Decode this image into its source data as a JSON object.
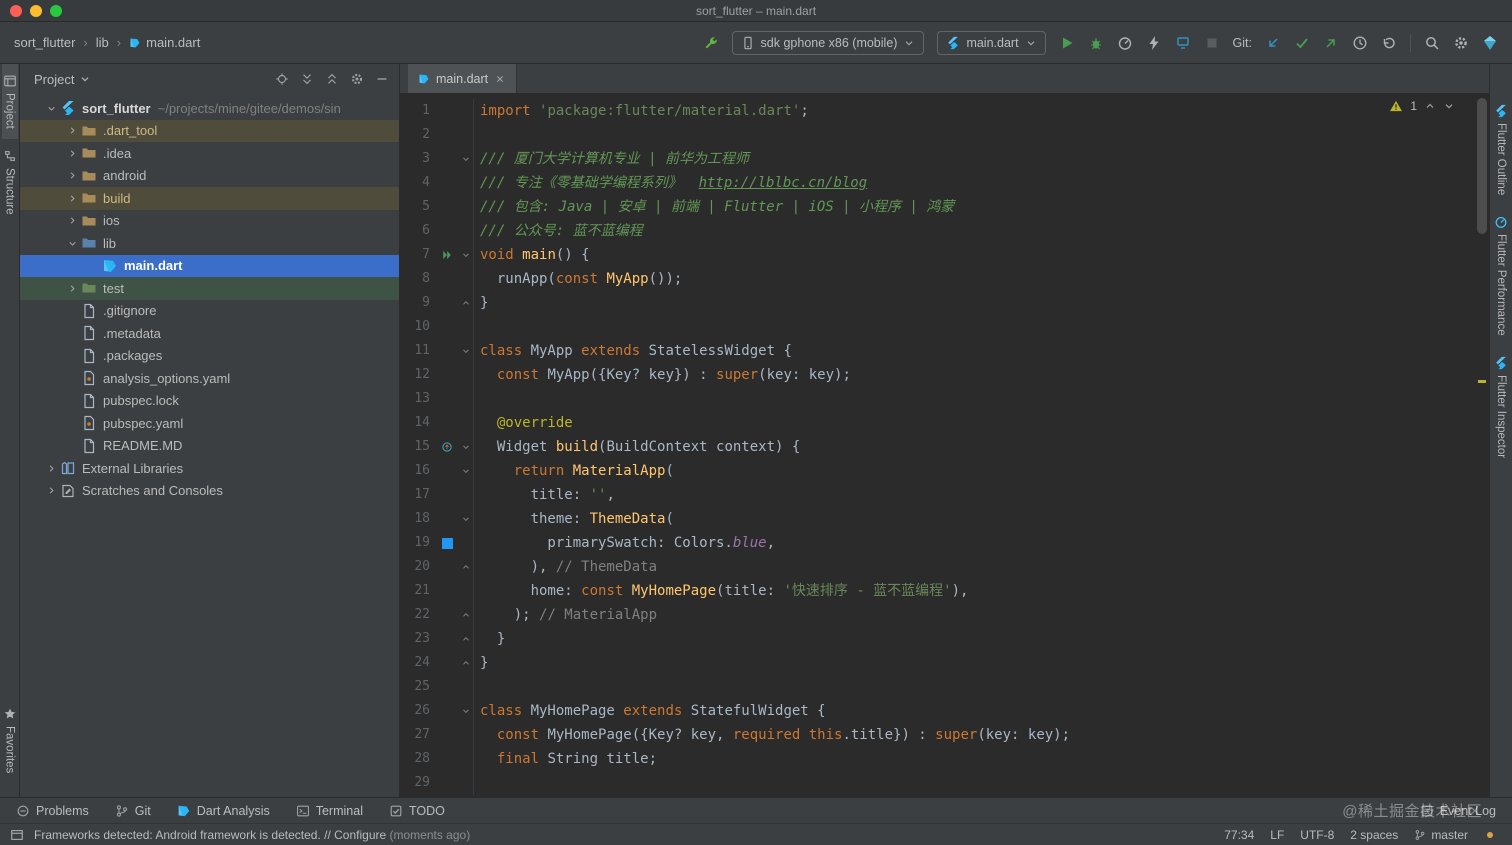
{
  "window": {
    "title": "sort_flutter – main.dart"
  },
  "breadcrumb": {
    "separator": "›",
    "items": [
      {
        "label": "sort_flutter"
      },
      {
        "label": "lib"
      },
      {
        "label": "main.dart",
        "icon": "dart"
      }
    ]
  },
  "toolbar": {
    "actions": [
      {
        "kind": "icon",
        "name": "flutter-attach-button",
        "icon": "wrench",
        "color": "#62B543"
      },
      {
        "kind": "select",
        "name": "device-selector",
        "icon": "phone",
        "icon_color": "#AFB1B3",
        "label": "sdk gphone x86 (mobile)"
      },
      {
        "kind": "select",
        "name": "run-config-selector",
        "icon": "flutter",
        "label": "main.dart"
      },
      {
        "kind": "icon",
        "name": "run-button",
        "icon": "play",
        "color": "#499C54"
      },
      {
        "kind": "icon",
        "name": "debug-button",
        "icon": "bug",
        "color": "#499C54"
      },
      {
        "kind": "icon",
        "name": "profile-button",
        "icon": "gauge",
        "color": "#AFB1B3"
      },
      {
        "kind": "icon",
        "name": "attach-debugger-button",
        "icon": "bolt",
        "color": "#AFB1B3"
      },
      {
        "kind": "icon",
        "name": "devtools-button",
        "icon": "devices",
        "color": "#3592C4"
      },
      {
        "kind": "icon",
        "name": "stop-button",
        "icon": "stop",
        "color": "#5A5D5E"
      },
      {
        "kind": "label",
        "name": "git-label",
        "text": "Git:"
      },
      {
        "kind": "icon",
        "name": "git-update-button",
        "icon": "arrowDL",
        "color": "#3592C4"
      },
      {
        "kind": "icon",
        "name": "git-commit-button",
        "icon": "check",
        "color": "#499C54"
      },
      {
        "kind": "icon",
        "name": "git-push-button",
        "icon": "arrowUR",
        "color": "#499C54"
      },
      {
        "kind": "icon",
        "name": "git-history-button",
        "icon": "clock",
        "color": "#AFB1B3"
      },
      {
        "kind": "icon",
        "name": "git-rollback-button",
        "icon": "undo",
        "color": "#AFB1B3"
      },
      {
        "kind": "sep"
      },
      {
        "kind": "icon",
        "name": "search-everywhere-button",
        "icon": "search",
        "color": "#AFB1B3"
      },
      {
        "kind": "icon",
        "name": "settings-button",
        "icon": "gear",
        "color": "#AFB1B3"
      },
      {
        "kind": "icon",
        "name": "plugin-profile-button",
        "icon": "gem",
        "color": "#54C5F8"
      }
    ]
  },
  "left_strip": {
    "top": [
      {
        "name": "tool-tab-project",
        "label": "Project",
        "icon": "projecttab",
        "active": true
      },
      {
        "name": "tool-tab-structure",
        "label": "Structure",
        "icon": "structure"
      }
    ],
    "bottom": [
      {
        "name": "tool-tab-favorites",
        "label": "Favorites",
        "icon": "star"
      }
    ]
  },
  "right_strip": {
    "tabs": [
      {
        "name": "tool-tab-flutter-outline",
        "label": "Flutter Outline",
        "icon": "flutter"
      },
      {
        "name": "tool-tab-flutter-performance",
        "label": "Flutter Performance",
        "icon": "gauge",
        "icon_color": "#40C4FF"
      },
      {
        "name": "tool-tab-flutter-inspector",
        "label": "Flutter Inspector",
        "icon": "flutter"
      }
    ]
  },
  "project_panel": {
    "title": "Project",
    "header_actions": [
      {
        "name": "locate-file-button",
        "icon": "crosshair"
      },
      {
        "name": "expand-all-button",
        "icon": "expandAll"
      },
      {
        "name": "collapse-all-button",
        "icon": "collapseAll"
      },
      {
        "name": "panel-settings-button",
        "icon": "gear"
      },
      {
        "name": "hide-panel-button",
        "icon": "minus"
      }
    ],
    "tree": [
      {
        "label": "sort_flutter",
        "suffix": "~/projects/mine/gitee/demos/sin",
        "chevron": "down",
        "icon": "flutter",
        "level": 0,
        "style": "root"
      },
      {
        "label": ".dart_tool",
        "chevron": "right",
        "icon": "folder",
        "level": 1,
        "row": "excluded"
      },
      {
        "label": ".idea",
        "chevron": "right",
        "icon": "folder",
        "level": 1
      },
      {
        "label": "android",
        "chevron": "right",
        "icon": "folder",
        "level": 1
      },
      {
        "label": "build",
        "chevron": "right",
        "icon": "folder",
        "level": 1,
        "row": "excluded"
      },
      {
        "label": "ios",
        "chevron": "right",
        "icon": "folder",
        "level": 1
      },
      {
        "label": "lib",
        "chevron": "down",
        "icon": "folderBlue",
        "level": 1
      },
      {
        "label": "main.dart",
        "icon": "dart",
        "level": 2,
        "row": "selected"
      },
      {
        "label": "test",
        "chevron": "right",
        "icon": "folderGreen",
        "level": 1,
        "row": "test"
      },
      {
        "label": ".gitignore",
        "icon": "file",
        "level": 1
      },
      {
        "label": ".metadata",
        "icon": "file",
        "level": 1
      },
      {
        "label": ".packages",
        "icon": "file",
        "level": 1
      },
      {
        "label": "analysis_options.yaml",
        "icon": "yaml",
        "level": 1
      },
      {
        "label": "pubspec.lock",
        "icon": "file",
        "level": 1
      },
      {
        "label": "pubspec.yaml",
        "icon": "yaml",
        "level": 1
      },
      {
        "label": "README.MD",
        "icon": "file",
        "level": 1
      },
      {
        "label": "External Libraries",
        "chevron": "right",
        "icon": "libraries",
        "level": 0
      },
      {
        "label": "Scratches and Consoles",
        "chevron": "right",
        "icon": "scratch",
        "level": 0
      }
    ]
  },
  "editor": {
    "tab": {
      "label": "main.dart"
    },
    "warning_count": "1",
    "lines": [
      {
        "n": 1,
        "t": [
          [
            "import ",
            "k"
          ],
          [
            "'package:flutter/material.dart'",
            "s"
          ],
          [
            ";",
            ""
          ]
        ]
      },
      {
        "n": 2,
        "t": []
      },
      {
        "n": 3,
        "f": "down",
        "t": [
          [
            "/// 厦门大学计算机专业 | 前华为工程师",
            "d"
          ]
        ]
      },
      {
        "n": 4,
        "t": [
          [
            "/// 专注《零基础学编程系列》  ",
            "d"
          ],
          [
            "http://lblbc.cn/blog",
            "dl"
          ]
        ]
      },
      {
        "n": 5,
        "t": [
          [
            "/// 包含: Java | 安卓 | 前端 | Flutter | iOS | 小程序 | 鸿蒙",
            "d"
          ]
        ]
      },
      {
        "n": 6,
        "t": [
          [
            "/// 公众号: 蓝不蓝编程",
            "d"
          ]
        ]
      },
      {
        "n": 7,
        "g": "run",
        "f": "down",
        "t": [
          [
            "void ",
            "k"
          ],
          [
            "main",
            "fn"
          ],
          [
            "() {",
            ""
          ]
        ]
      },
      {
        "n": 8,
        "t": [
          [
            "  runApp(",
            ""
          ],
          [
            "const ",
            "k"
          ],
          [
            "MyApp",
            "fn"
          ],
          [
            "());",
            ""
          ]
        ]
      },
      {
        "n": 9,
        "f": "up",
        "t": [
          [
            "}",
            ""
          ]
        ]
      },
      {
        "n": 10,
        "t": []
      },
      {
        "n": 11,
        "f": "down",
        "t": [
          [
            "class ",
            "k"
          ],
          [
            "MyApp ",
            ""
          ],
          [
            "extends ",
            "k"
          ],
          [
            "StatelessWidget {",
            ""
          ]
        ]
      },
      {
        "n": 12,
        "t": [
          [
            "  const ",
            "k"
          ],
          [
            "MyApp({Key? key}) : ",
            ""
          ],
          [
            "super",
            "k"
          ],
          [
            "(key: key);",
            ""
          ]
        ]
      },
      {
        "n": 13,
        "t": []
      },
      {
        "n": 14,
        "t": [
          [
            "  ",
            ""
          ],
          [
            "@override",
            "a"
          ]
        ]
      },
      {
        "n": 15,
        "g": "override",
        "f": "down",
        "t": [
          [
            "  Widget ",
            ""
          ],
          [
            "build",
            "fn"
          ],
          [
            "(BuildContext context) {",
            ""
          ]
        ]
      },
      {
        "n": 16,
        "f": "down",
        "t": [
          [
            "    ",
            ""
          ],
          [
            "return ",
            "k"
          ],
          [
            "MaterialApp",
            "fn"
          ],
          [
            "(",
            ""
          ]
        ]
      },
      {
        "n": 17,
        "t": [
          [
            "      title: ",
            ""
          ],
          [
            "''",
            "s"
          ],
          [
            ",",
            ""
          ]
        ]
      },
      {
        "n": 18,
        "f": "down",
        "t": [
          [
            "      theme: ",
            ""
          ],
          [
            "ThemeData",
            "fn"
          ],
          [
            "(",
            ""
          ]
        ]
      },
      {
        "n": 19,
        "g": "color",
        "t": [
          [
            "        primarySwatch: Colors.",
            ""
          ],
          [
            "blue",
            "m"
          ],
          [
            ",",
            ""
          ]
        ]
      },
      {
        "n": 20,
        "f": "up",
        "t": [
          [
            "      ), ",
            ""
          ],
          [
            "// ThemeData",
            "c"
          ]
        ]
      },
      {
        "n": 21,
        "t": [
          [
            "      home: ",
            ""
          ],
          [
            "const ",
            "k"
          ],
          [
            "MyHomePage",
            "fn"
          ],
          [
            "(title: ",
            ""
          ],
          [
            "'快速排序 - 蓝不蓝编程'",
            "s"
          ],
          [
            "),",
            ""
          ]
        ]
      },
      {
        "n": 22,
        "f": "up",
        "t": [
          [
            "    ); ",
            ""
          ],
          [
            "// MaterialApp",
            "c"
          ]
        ]
      },
      {
        "n": 23,
        "f": "up",
        "t": [
          [
            "  }",
            ""
          ]
        ]
      },
      {
        "n": 24,
        "f": "up",
        "t": [
          [
            "}",
            ""
          ]
        ]
      },
      {
        "n": 25,
        "t": []
      },
      {
        "n": 26,
        "f": "down",
        "t": [
          [
            "class ",
            "k"
          ],
          [
            "MyHomePage ",
            ""
          ],
          [
            "extends ",
            "k"
          ],
          [
            "StatefulWidget {",
            ""
          ]
        ]
      },
      {
        "n": 27,
        "t": [
          [
            "  const ",
            "k"
          ],
          [
            "MyHomePage({Key? key, ",
            ""
          ],
          [
            "required ",
            "k"
          ],
          [
            "this",
            "k"
          ],
          [
            ".title}) : ",
            ""
          ],
          [
            "super",
            "k"
          ],
          [
            "(key: key);",
            ""
          ]
        ]
      },
      {
        "n": 28,
        "t": [
          [
            "  ",
            ""
          ],
          [
            "final ",
            "k"
          ],
          [
            "String title;",
            ""
          ]
        ]
      },
      {
        "n": 29,
        "t": []
      }
    ],
    "syntax_colors": {
      "keyword": "#CC7832",
      "string": "#6A8759",
      "doc_comment": "#629755",
      "comment": "#808080",
      "function": "#FFC66D",
      "annotation": "#BBB529",
      "member": "#9876AA",
      "default": "#A9B7C6"
    },
    "color_swatch": "#2196F3"
  },
  "bottom_bar": {
    "left": [
      {
        "name": "tool-button-problems",
        "label": "Problems",
        "icon": "problems"
      },
      {
        "name": "tool-button-git",
        "label": "Git",
        "icon": "branch"
      },
      {
        "name": "tool-button-dart-analysis",
        "label": "Dart Analysis",
        "icon": "dartSmall"
      },
      {
        "name": "tool-button-terminal",
        "label": "Terminal",
        "icon": "terminal"
      },
      {
        "name": "tool-button-todo",
        "label": "TODO",
        "icon": "todo"
      }
    ],
    "right": [
      {
        "name": "tool-button-event-log",
        "label": "Event Log",
        "icon": "eventlog"
      }
    ],
    "watermark": "@稀土掘金技术社区"
  },
  "status_bar": {
    "message": "Frameworks detected: Android framework is detected. // ",
    "action": "Configure",
    "time": " (moments ago)",
    "widgets": [
      {
        "name": "caret-position",
        "label": "77:34"
      },
      {
        "name": "line-separator",
        "label": "LF"
      },
      {
        "name": "file-encoding",
        "label": "UTF-8"
      },
      {
        "name": "indent-style",
        "label": "2 spaces"
      },
      {
        "name": "git-branch",
        "label": "master",
        "icon": "branch"
      },
      {
        "name": "inspections-level",
        "label": "",
        "icon": "dot",
        "icon_color": "#D9A343"
      }
    ]
  },
  "colors": {
    "selection": "#3B6EC9",
    "excluded_row": "#504C3B",
    "test_row": "#3E5345",
    "panel_bg": "#3C3F41",
    "editor_bg": "#2B2B2B",
    "accent_green": "#499C54"
  }
}
